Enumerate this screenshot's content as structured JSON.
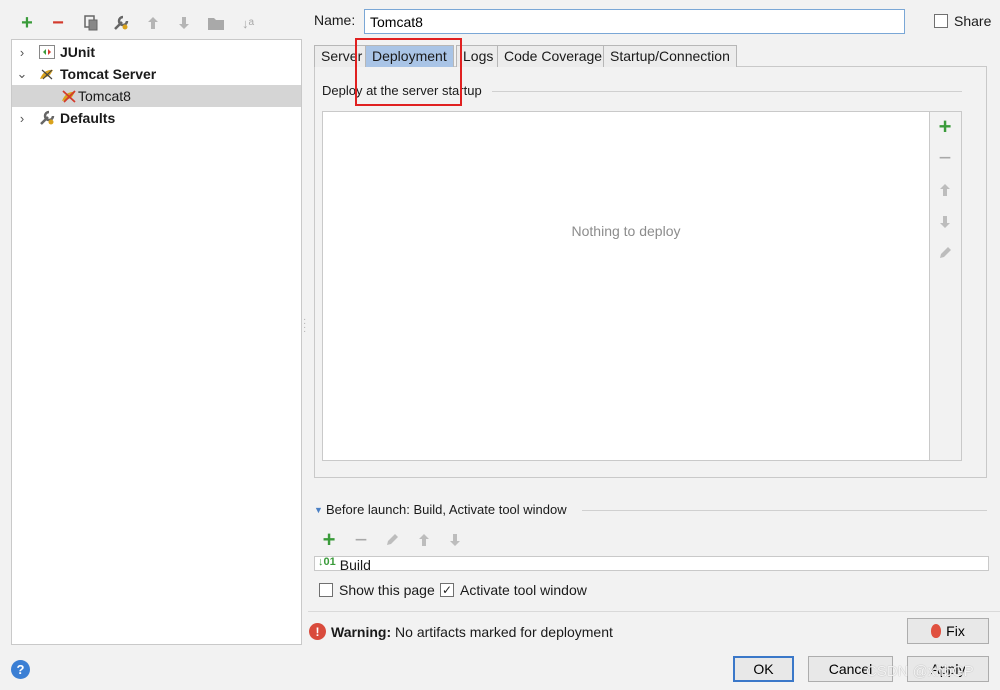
{
  "toolbar": {
    "icons": [
      "add-icon",
      "remove-icon",
      "copy-icon",
      "wrench-icon",
      "arrow-up-icon",
      "arrow-down-icon",
      "folder-icon",
      "sort-icon"
    ]
  },
  "tree": {
    "items": [
      {
        "label": "JUnit",
        "expanded": false,
        "level": 0
      },
      {
        "label": "Tomcat Server",
        "expanded": true,
        "level": 0
      },
      {
        "label": "Tomcat8",
        "level": 1,
        "selected": true
      },
      {
        "label": "Defaults",
        "expanded": false,
        "level": 0
      }
    ]
  },
  "form": {
    "name_label": "Name:",
    "name_value": "Tomcat8",
    "share_label": "Share"
  },
  "tabs": [
    {
      "label": "Server"
    },
    {
      "label": "Deployment",
      "active": true
    },
    {
      "label": "Logs"
    },
    {
      "label": "Code Coverage"
    },
    {
      "label": "Startup/Connection"
    }
  ],
  "deployment": {
    "section_title": "Deploy at the server startup",
    "empty_text": "Nothing to deploy"
  },
  "before_launch": {
    "title": "Before launch: Build, Activate tool window",
    "items": [
      {
        "label": "Build"
      }
    ]
  },
  "options": {
    "show_page_label": "Show this page",
    "show_page_checked": false,
    "activate_label": "Activate tool window",
    "activate_checked": true
  },
  "warning": {
    "bold": "Warning:",
    "text": " No artifacts marked for deployment"
  },
  "buttons": {
    "fix": "Fix",
    "ok": "OK",
    "cancel": "Cancel",
    "apply": "Apply",
    "help": "?"
  },
  "watermark": "CSDN @xhbGP",
  "colors": {
    "active_tab": "#a9c4e6",
    "highlight": "#e02020",
    "add_green": "#3a9b3a",
    "remove_red": "#d33a2c"
  }
}
